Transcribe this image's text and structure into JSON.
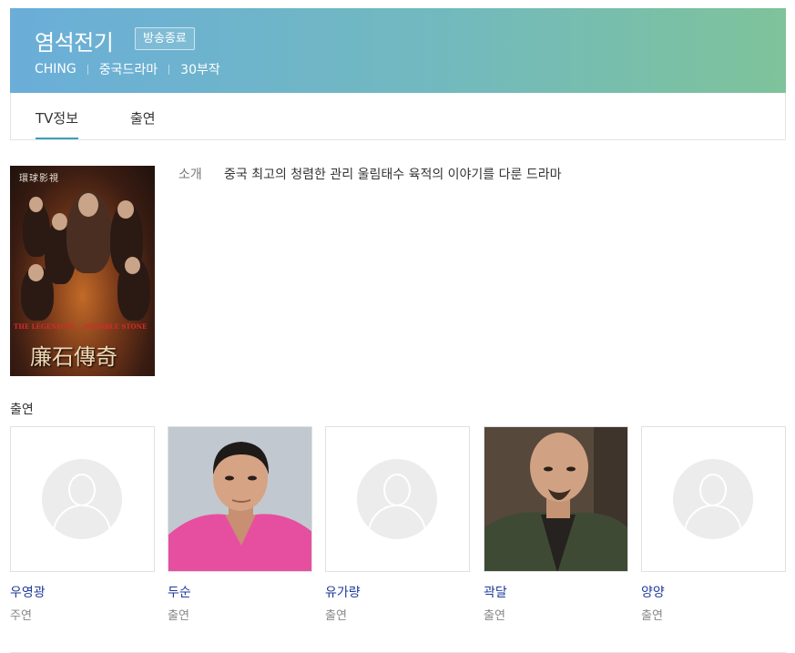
{
  "header": {
    "title": "염석전기",
    "badge": "방송종료",
    "meta": [
      "CHING",
      "중국드라마",
      "30부작"
    ]
  },
  "tabs": [
    {
      "label": "TV정보",
      "active": true
    },
    {
      "label": "출연",
      "active": false
    }
  ],
  "poster": {
    "top_text": "環球影視",
    "english_title": "THE LEGEND OF ...NOTABLE STONE",
    "chinese_title": "廉石傳奇"
  },
  "intro": {
    "label": "소개",
    "text": "중국 최고의 청렴한 관리 울림태수 육적의 이야기를 다룬 드라마"
  },
  "cast_section": {
    "title": "출연",
    "members": [
      {
        "name": "우영광",
        "role": "주연",
        "photo": "placeholder"
      },
      {
        "name": "두순",
        "role": "출연",
        "photo": "photo"
      },
      {
        "name": "유가량",
        "role": "출연",
        "photo": "placeholder"
      },
      {
        "name": "곽달",
        "role": "출연",
        "photo": "photo"
      },
      {
        "name": "양양",
        "role": "출연",
        "photo": "placeholder"
      }
    ]
  },
  "colors": {
    "header_start": "#6aaed9",
    "header_end": "#7ec39a",
    "tab_underline": "#3aa0b8",
    "cast_name": "#1f3a9c"
  }
}
